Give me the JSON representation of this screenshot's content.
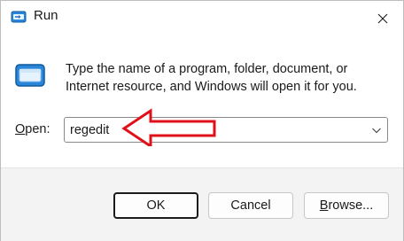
{
  "window": {
    "title": "Run"
  },
  "icons": {
    "app": "run-icon",
    "dialog": "run-icon",
    "close": "close-icon",
    "dropdown": "chevron-down-icon",
    "annotation": "red-arrow-icon"
  },
  "description": "Type the name of a program, folder, document, or Internet resource, and Windows will open it for you.",
  "open": {
    "label_prefix": "",
    "label_accel": "O",
    "label_rest": "pen:",
    "value": "regedit"
  },
  "buttons": {
    "ok": "OK",
    "cancel": "Cancel",
    "browse_accel": "B",
    "browse_rest": "rowse..."
  },
  "colors": {
    "accent": "#0067c0",
    "annotation": "#e0101a"
  }
}
